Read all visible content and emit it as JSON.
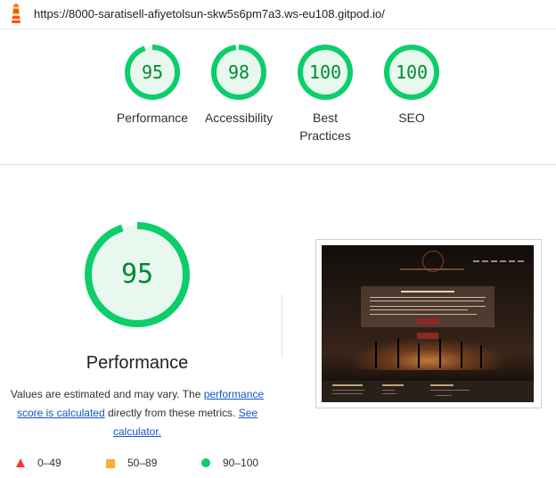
{
  "browser": {
    "url": "https://8000-saratisell-afiyetolsun-skw5s6pm7a3.ws-eu108.gitpod.io/"
  },
  "categories": [
    {
      "label": "Performance",
      "score": "95",
      "fill": 0.95
    },
    {
      "label": "Accessibility",
      "score": "98",
      "fill": 0.98
    },
    {
      "label": "Best Practices",
      "score": "100",
      "fill": 1.0
    },
    {
      "label": "SEO",
      "score": "100",
      "fill": 1.0
    }
  ],
  "detail": {
    "score": "95",
    "fill": 0.95,
    "title": "Performance",
    "desc_part1": "Values are estimated and may vary. The ",
    "desc_link1": "performance score is calculated",
    "desc_part2": " directly from these metrics. ",
    "desc_link2": "See calculator."
  },
  "legend": [
    {
      "range": "0–49",
      "color": "#ff3333"
    },
    {
      "range": "50–89",
      "color": "#ffaa33"
    },
    {
      "range": "90–100",
      "color": "#0cce6b"
    }
  ],
  "colors": {
    "pass_ring": "#0cce6b",
    "pass_bg": "#e8f8ee",
    "pass_text": "#008a34"
  }
}
